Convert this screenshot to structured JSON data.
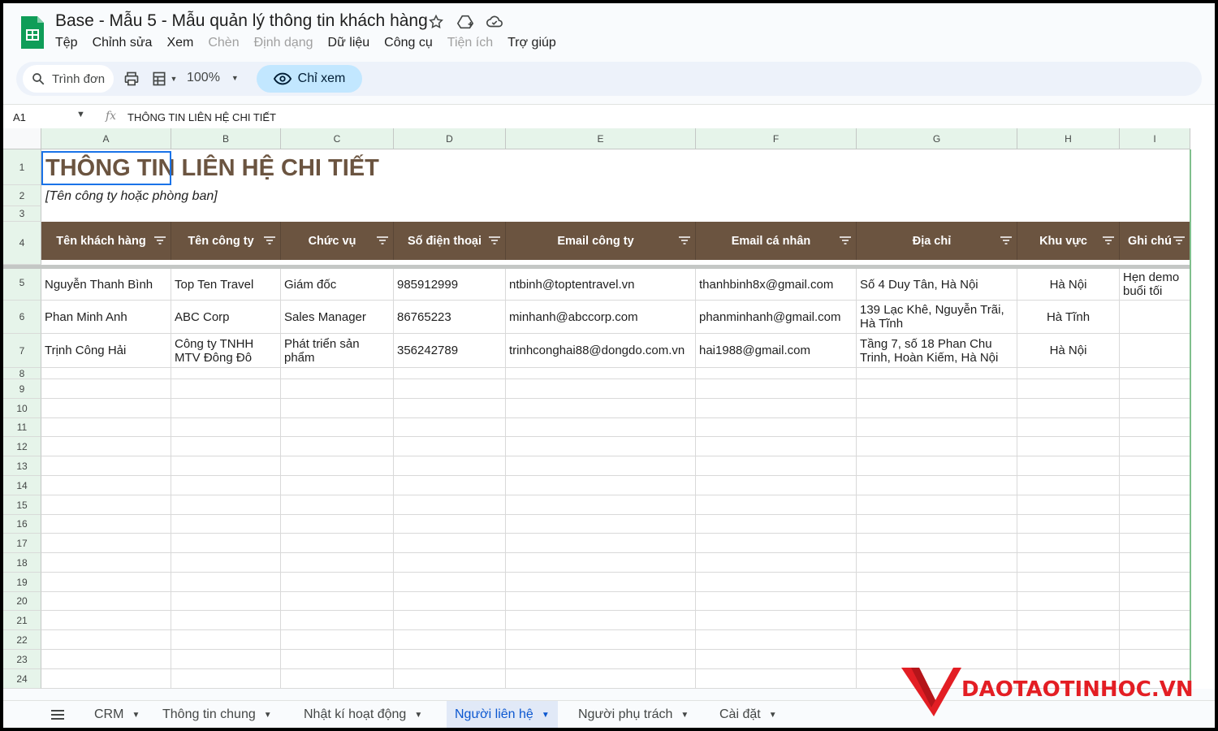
{
  "doc": {
    "title": "Base - Mẫu 5 - Mẫu quản lý thông tin khách hàng"
  },
  "menu": [
    "Tệp",
    "Chỉnh sửa",
    "Xem",
    "Chèn",
    "Định dạng",
    "Dữ liệu",
    "Công cụ",
    "Tiện ích",
    "Trợ giúp"
  ],
  "toolbar": {
    "search_label": "Trình đơn",
    "zoom": "100%",
    "view_only": "Chỉ xem"
  },
  "formula_bar": {
    "cell_ref": "A1",
    "content": "THÔNG TIN LIÊN HỆ CHI TIẾT"
  },
  "columns": [
    "A",
    "B",
    "C",
    "D",
    "E",
    "F",
    "G",
    "H",
    "I"
  ],
  "rows": [
    "1",
    "2",
    "3",
    "4",
    "5",
    "6",
    "7",
    "8",
    "9",
    "10",
    "11",
    "12",
    "13",
    "14",
    "15",
    "16",
    "17",
    "18",
    "19",
    "20",
    "21",
    "22",
    "23",
    "24"
  ],
  "sheet": {
    "title": "THÔNG TIN LIÊN HỆ CHI TIẾT",
    "subtitle": "[Tên công ty hoặc phòng ban]",
    "headers": [
      "Tên khách hàng",
      "Tên công ty",
      "Chức vụ",
      "Số điện thoại",
      "Email công ty",
      "Email cá nhân",
      "Địa chỉ",
      "Khu vực",
      "Ghi chú"
    ],
    "data": [
      [
        "Nguyễn Thanh Bình",
        "Top Ten Travel",
        "Giám đốc",
        "985912999",
        "ntbinh@toptentravel.vn",
        "thanhbinh8x@gmail.com",
        "Số 4 Duy Tân, Hà Nội",
        "Hà Nội",
        "Hẹn demo buổi tối"
      ],
      [
        "Phan Minh Anh",
        "ABC Corp",
        "Sales Manager",
        "86765223",
        "minhanh@abccorp.com",
        "phanminhanh@gmail.com",
        "139 Lạc Khê, Nguyễn Trãi, Hà Tĩnh",
        "Hà Tĩnh",
        ""
      ],
      [
        "Trịnh Công Hải",
        "Công ty TNHH MTV Đông Đô",
        "Phát triển sản phẩm",
        "356242789",
        "trinhconghai88@dongdo.com.vn",
        "hai1988@gmail.com",
        "Tầng 7, số 18 Phan Chu Trinh, Hoàn Kiếm, Hà Nội",
        "Hà Nội",
        ""
      ]
    ]
  },
  "tabs": [
    {
      "label": "CRM",
      "active": false
    },
    {
      "label": "Thông tin chung",
      "active": false
    },
    {
      "label": "Nhật kí hoạt động",
      "active": false
    },
    {
      "label": "Người liên hệ",
      "active": true
    },
    {
      "label": "Người phụ trách",
      "active": false
    },
    {
      "label": "Cài đặt",
      "active": false
    }
  ],
  "watermark": "DAOTAOTINHOC.VN",
  "colors": {
    "header_brown": "#6b5440",
    "accent_blue": "#0b57d0",
    "sheets_green": "#0f9d58",
    "watermark_red": "#e31e24"
  }
}
